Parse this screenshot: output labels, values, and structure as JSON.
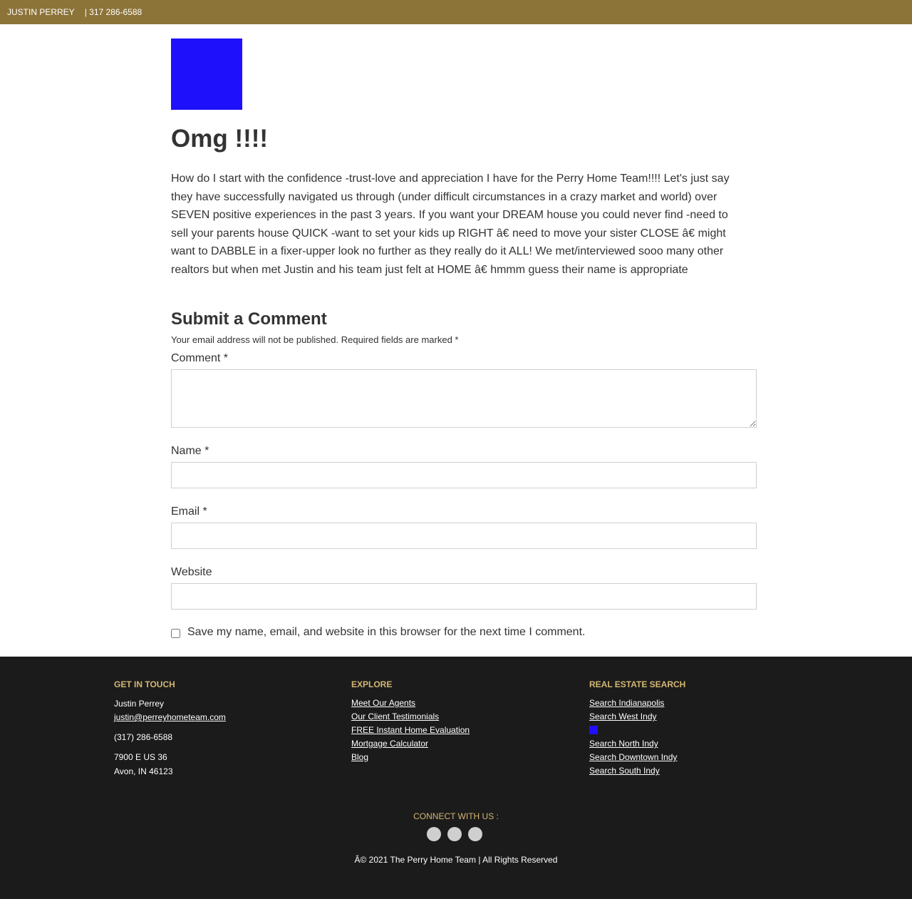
{
  "topbar": {
    "name": "JUSTIN PERREY",
    "phone": "| 317 286-6588"
  },
  "post": {
    "image_color": "#1f10fb",
    "title": "Omg !!!!",
    "body": "How do I start with the confidence -trust-love and appreciation I have for the Perry Home Team!!!! Let's just say they have successfully navigated us through (under difficult circumstances in a crazy market and world) over SEVEN positive experiences in the past 3 years. If you want your DREAM house you could never find -need to sell your parents house QUICK -want to set your kids up RIGHT â€    need to move your sister CLOSE â€     might want to DABBLE in a fixer-upper look no further as they really do it ALL! We met/interviewed sooo many other realtors but when met Justin and his team just felt at HOME â€    hmmm guess their name is appropriate"
  },
  "comment_form": {
    "title": "Submit a Comment",
    "notes": "Your email address will not be published. Required fields are marked *",
    "comment_label": "Comment *",
    "name_label": "Name *",
    "email_label": "Email *",
    "website_label": "Website",
    "consent_label": "Save my name, email, and website in this browser for the next time I comment."
  },
  "footer": {
    "get_in_touch": {
      "heading": "GET IN TOUCH",
      "name": "Justin Perrey",
      "email": "justin@perreyhometeam.com",
      "phone": "(317) 286-6588",
      "address_line1": "7900 E US 36",
      "address_line2": "Avon, IN 46123"
    },
    "explore": {
      "heading": "EXPLORE",
      "links": [
        "Meet Our Agents",
        "Our Client Testimonials",
        "FREE Instant Home Evaluation",
        "Mortgage Calculator",
        "Blog"
      ]
    },
    "real_estate_search": {
      "heading": "REAL ESTATE SEARCH",
      "links": [
        "Search Indianapolis",
        "Search West Indy",
        "Search North Indy",
        "Search Downtown Indy",
        "Search South Indy"
      ]
    },
    "connect_label": "CONNECT WITH US :",
    "copyright": "Â© 2021 The Perry Home Team | All Rights Reserved"
  },
  "colors": {
    "topbar_bg": "#8c7338",
    "footer_bg": "#1b1b1b",
    "footer_heading": "#d3b773",
    "placeholder_image": "#1f10fb"
  }
}
